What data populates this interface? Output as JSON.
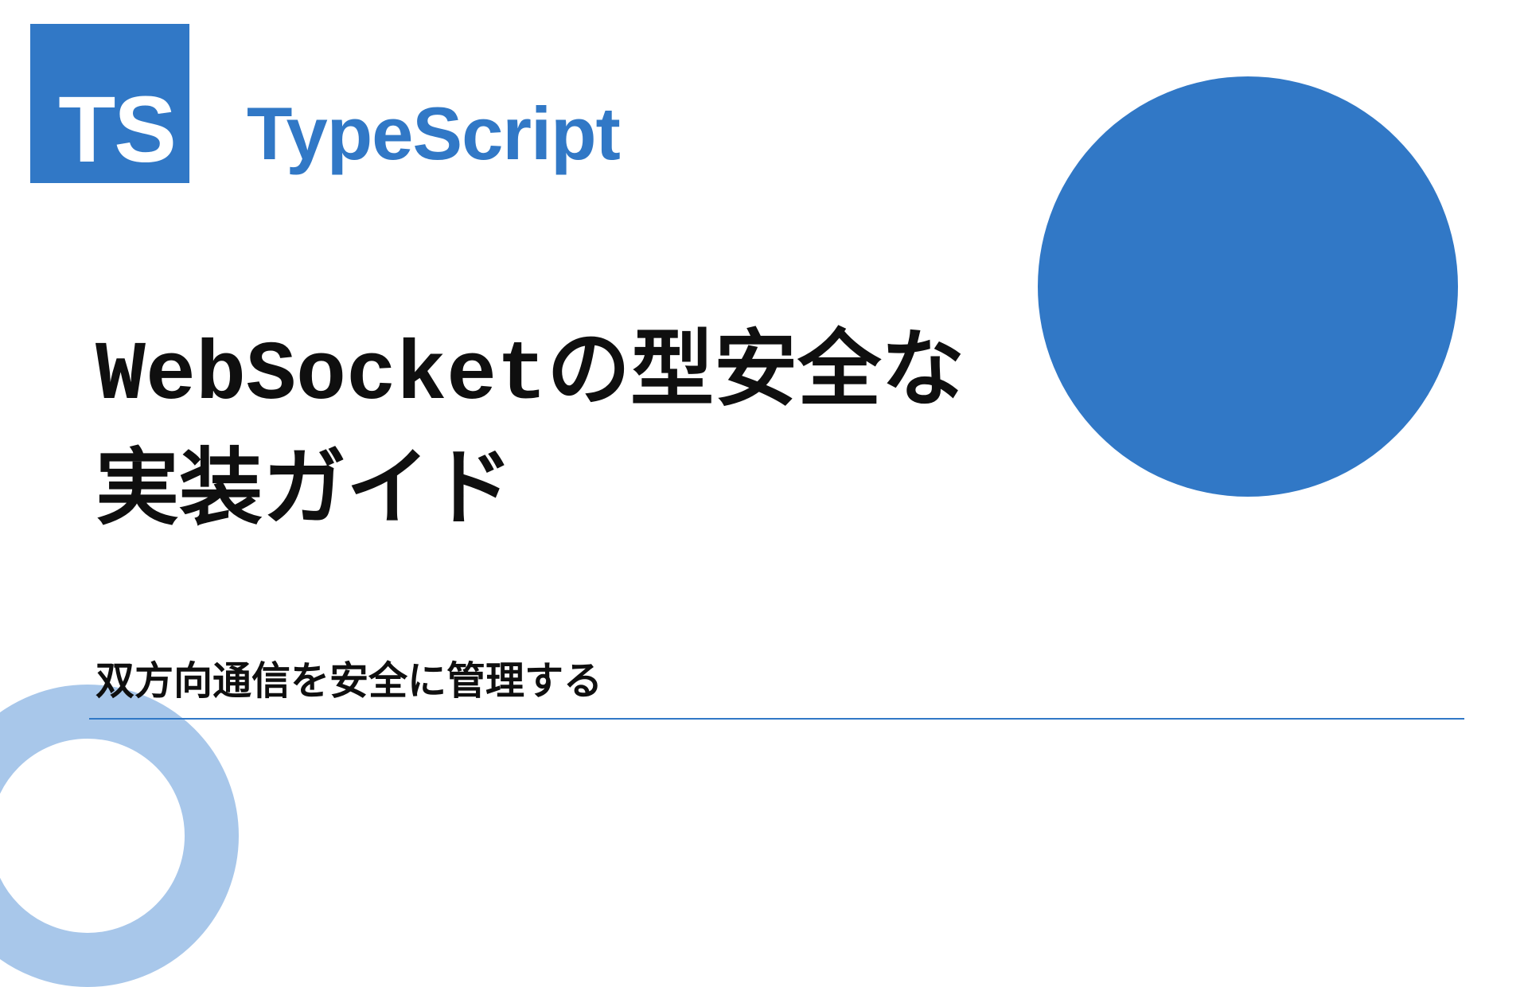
{
  "logo": {
    "abbr": "TS",
    "brand": "TypeScript"
  },
  "title": "WebSocketの型安全な実装ガイド",
  "subtitle": "双方向通信を安全に管理する",
  "colors": {
    "primary": "#3178c6",
    "ring": "#a8c7ea",
    "text": "#0f0f0f"
  }
}
